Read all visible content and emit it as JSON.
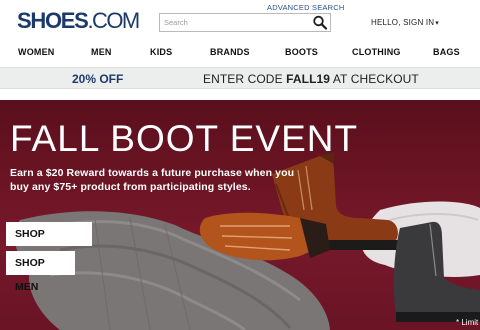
{
  "header": {
    "logo_text_main": "SHOES",
    "logo_text_dot": ".COM",
    "advanced_search": "ADVANCED SEARCH",
    "search_placeholder": "Search",
    "account_label": "HELLO, SIGN IN",
    "account_icon": "chevron-down-icon"
  },
  "nav": {
    "items": [
      {
        "label": "WOMEN"
      },
      {
        "label": "MEN"
      },
      {
        "label": "KIDS"
      },
      {
        "label": "BRANDS"
      },
      {
        "label": "BOOTS"
      },
      {
        "label": "CLOTHING"
      },
      {
        "label": "BAGS"
      }
    ]
  },
  "promo": {
    "discount": "20% OFF",
    "code_prefix": "ENTER CODE ",
    "code": "FALL19",
    "code_suffix": " AT CHECKOUT"
  },
  "hero": {
    "title": "FALL BOOT EVENT",
    "subtitle": "Earn a $20 Reward towards a future purchase when you buy any $75+ product from participating styles.",
    "shop_women": "SHOP WOMEN",
    "shop_men": "SHOP MEN",
    "footnote": "* Limit"
  },
  "colors": {
    "brand": "#1b3a6b",
    "hero_background": "#6b1424",
    "promo_background": "#eceded"
  }
}
